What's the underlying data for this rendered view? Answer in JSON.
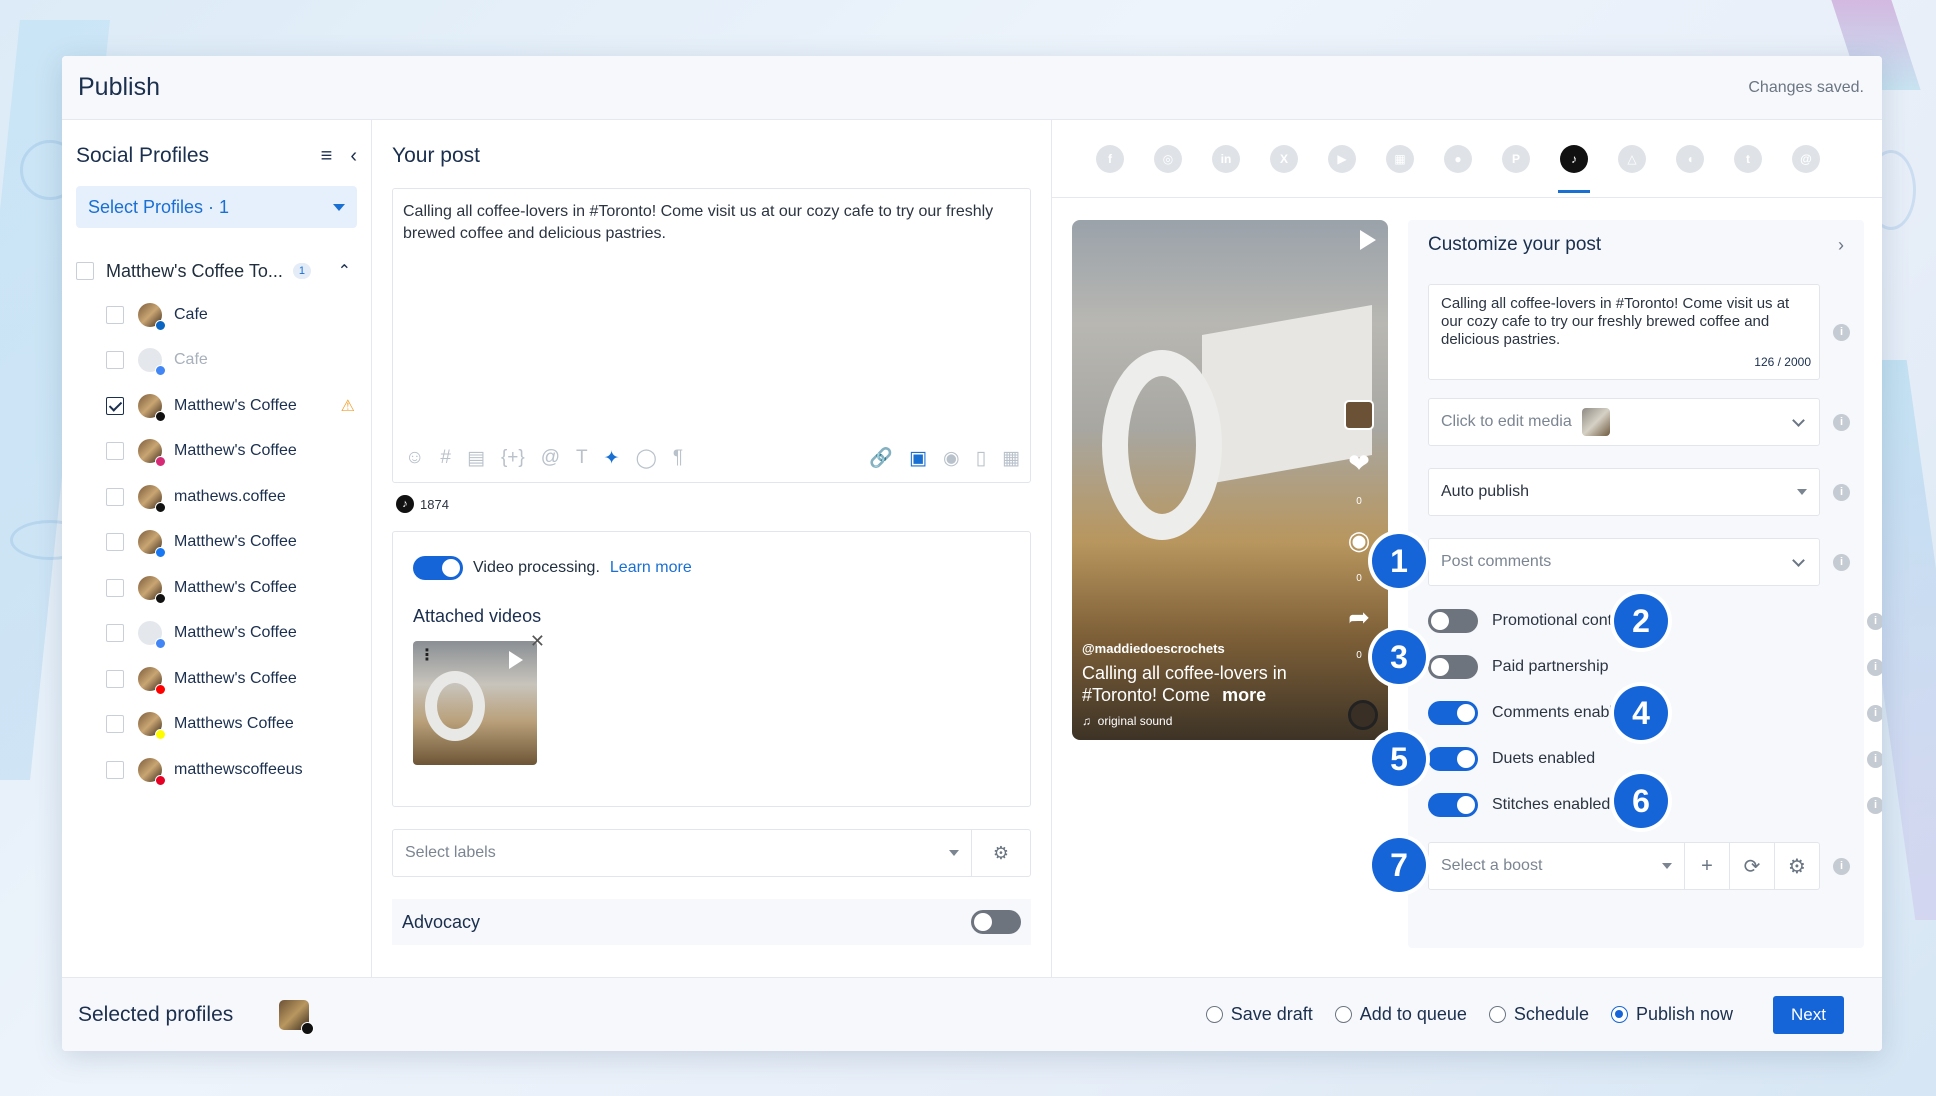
{
  "header": {
    "title": "Publish",
    "status": "Changes saved."
  },
  "profiles": {
    "title": "Social Profiles",
    "select_label": "Select Profiles · 1",
    "group": {
      "name": "Matthew's Coffee To...",
      "count": "1"
    },
    "items": [
      {
        "name": "Cafe",
        "network": "linkedin",
        "checked": false,
        "disabled": false
      },
      {
        "name": "Cafe",
        "network": "google-business",
        "checked": false,
        "disabled": true
      },
      {
        "name": "Matthew's Coffee",
        "network": "tiktok",
        "checked": true,
        "disabled": false,
        "warning": true
      },
      {
        "name": "Matthew's Coffee",
        "network": "instagram",
        "checked": false,
        "disabled": false
      },
      {
        "name": "mathews.coffee",
        "network": "threads",
        "checked": false,
        "disabled": false
      },
      {
        "name": "Matthew's Coffee",
        "network": "facebook",
        "checked": false,
        "disabled": false
      },
      {
        "name": "Matthew's Coffee",
        "network": "x",
        "checked": false,
        "disabled": false
      },
      {
        "name": "Matthew's Coffee",
        "network": "google-business",
        "checked": false,
        "disabled": false
      },
      {
        "name": "Matthew's Coffee",
        "network": "youtube",
        "checked": false,
        "disabled": false
      },
      {
        "name": "Matthews Coffee",
        "network": "snapchat",
        "checked": false,
        "disabled": false
      },
      {
        "name": "matthewscoffeeus",
        "network": "pinterest",
        "checked": false,
        "disabled": false
      }
    ]
  },
  "post": {
    "title": "Your post",
    "text": "Calling all coffee-lovers in #Toronto! Come visit us at our cozy cafe to try our freshly brewed coffee and delicious pastries.",
    "tiktok_count": "1874",
    "video_processing_label": "Video processing.",
    "learn_more": "Learn more",
    "attached_videos_title": "Attached videos",
    "labels_placeholder": "Select labels",
    "advocacy_label": "Advocacy"
  },
  "preview": {
    "username": "@maddiedoescrochets",
    "caption": "Calling all coffee-lovers in #Toronto! Come",
    "more": "more",
    "sound": "original sound",
    "counts": {
      "likes": "0",
      "comments": "0",
      "shares": "0"
    }
  },
  "customize": {
    "title": "Customize your post",
    "caption": "Calling all coffee-lovers in #Toronto! Come visit us at our cozy cafe to try our freshly brewed coffee and delicious pastries.",
    "char_count": "126 / 2000",
    "edit_media": "Click to edit media",
    "publish_mode": "Auto publish",
    "post_comments": "Post comments",
    "toggles": [
      {
        "label": "Promotional content",
        "on": false,
        "badge": "2"
      },
      {
        "label": "Paid partnership",
        "on": false,
        "badge": "3"
      },
      {
        "label": "Comments enabled",
        "on": true,
        "badge": "4"
      },
      {
        "label": "Duets enabled",
        "on": true,
        "badge": "5"
      },
      {
        "label": "Stitches enabled",
        "on": true,
        "badge": "6"
      }
    ],
    "post_comments_badge": "1",
    "boost_placeholder": "Select a boost",
    "boost_badge": "7"
  },
  "footer": {
    "selected_profiles": "Selected profiles",
    "options": [
      "Save draft",
      "Add to queue",
      "Schedule",
      "Publish now"
    ],
    "selected_option": "Publish now",
    "next": "Next"
  },
  "colors": {
    "accent": "#1565d8",
    "link": "#1a6fd3",
    "navy": "#1b2f4e"
  }
}
